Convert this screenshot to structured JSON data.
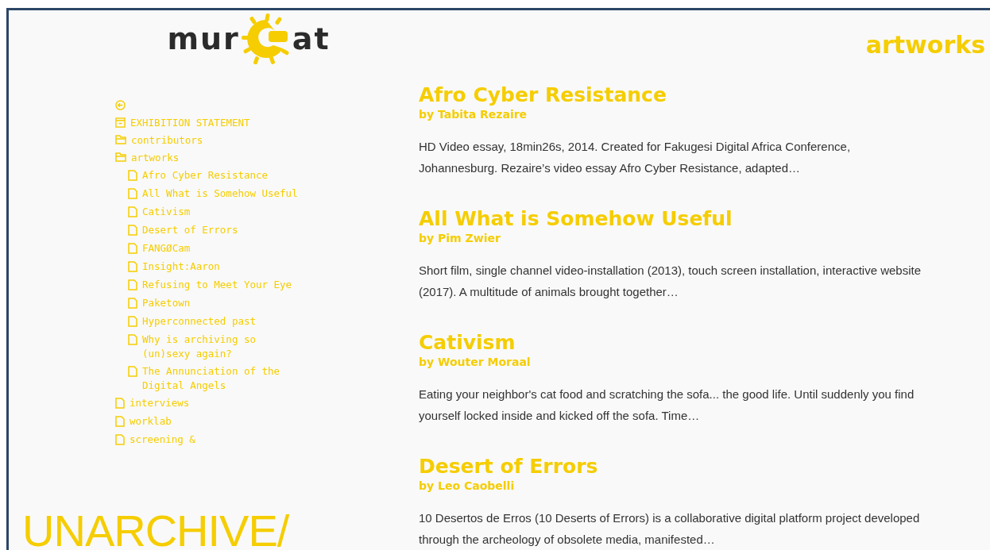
{
  "logo": {
    "left": "mur",
    "right": "at"
  },
  "section_title": "artworks",
  "nav": [
    {
      "kind": "back"
    },
    {
      "kind": "statement",
      "label": "EXHIBITION STATEMENT"
    },
    {
      "kind": "folder",
      "label": "contributors"
    },
    {
      "kind": "folder",
      "label": "artworks",
      "children": [
        {
          "kind": "file",
          "label": "Afro Cyber Resistance"
        },
        {
          "kind": "file",
          "label": "All What is Somehow Useful"
        },
        {
          "kind": "file",
          "label": "Cativism"
        },
        {
          "kind": "file",
          "label": "Desert of Errors"
        },
        {
          "kind": "file",
          "label": "FANGØCam"
        },
        {
          "kind": "file",
          "label": "Insight:Aaron"
        },
        {
          "kind": "file",
          "label": "Refusing to Meet Your Eye"
        },
        {
          "kind": "file",
          "label": "Paketown"
        },
        {
          "kind": "file",
          "label": "Hyperconnected past"
        },
        {
          "kind": "file",
          "label": "Why is archiving so (un)sexy again?"
        },
        {
          "kind": "file",
          "label": "The Annunciation of the Digital Angels"
        }
      ]
    },
    {
      "kind": "file",
      "label": "interviews"
    },
    {
      "kind": "file",
      "label": "worklab"
    },
    {
      "kind": "file",
      "label": "screening &"
    }
  ],
  "exhibition_title": "UNARCHIVE/",
  "artworks": [
    {
      "title": "Afro Cyber Resistance",
      "author": "by Tabita Rezaire",
      "summary": "HD Video essay, 18min26s, 2014. Created for Fakugesi Digital Africa Conference, Johannesburg. Rezaire’s video essay Afro Cyber Resistance, adapted…"
    },
    {
      "title": "All What is Somehow Useful",
      "author": "by Pim Zwier",
      "summary": "Short film, single channel video-installation (2013), touch screen installation, interactive website (2017). A multitude of animals brought together…"
    },
    {
      "title": "Cativism",
      "author": "by Wouter Moraal",
      "summary": "Eating your neighbor's cat food and scratching the sofa... the good life. Until suddenly you find yourself locked inside and kicked off the sofa. Time…"
    },
    {
      "title": "Desert of Errors",
      "author": "by Leo Caobelli",
      "summary": "10 Desertos de Erros (10 Deserts of Errors) is a collaborative digital platform project developed through the archeology of obsolete media, manifested…"
    }
  ]
}
